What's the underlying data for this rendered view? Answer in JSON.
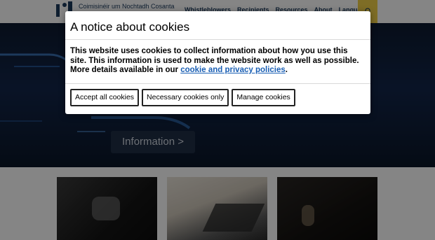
{
  "header": {
    "org_name": "Coimisinéir um Nochtadh Cosanta",
    "nav": [
      "Whistleblowers",
      "Recipients",
      "Resources",
      "About",
      "Languages"
    ],
    "search_icon": "search-icon"
  },
  "hero": {
    "button_label": "Information >"
  },
  "cookie_modal": {
    "title": "A notice about cookies",
    "body_line1": "This website uses cookies to collect information about how you use this site. This information is used to make the website work as well as possible.",
    "body_line2_prefix": "More details available in our ",
    "body_link": "cookie and privacy policies",
    "body_line2_suffix": ".",
    "buttons": {
      "accept_all": "Accept all cookies",
      "necessary": "Necessary cookies only",
      "manage": "Manage cookies"
    }
  }
}
